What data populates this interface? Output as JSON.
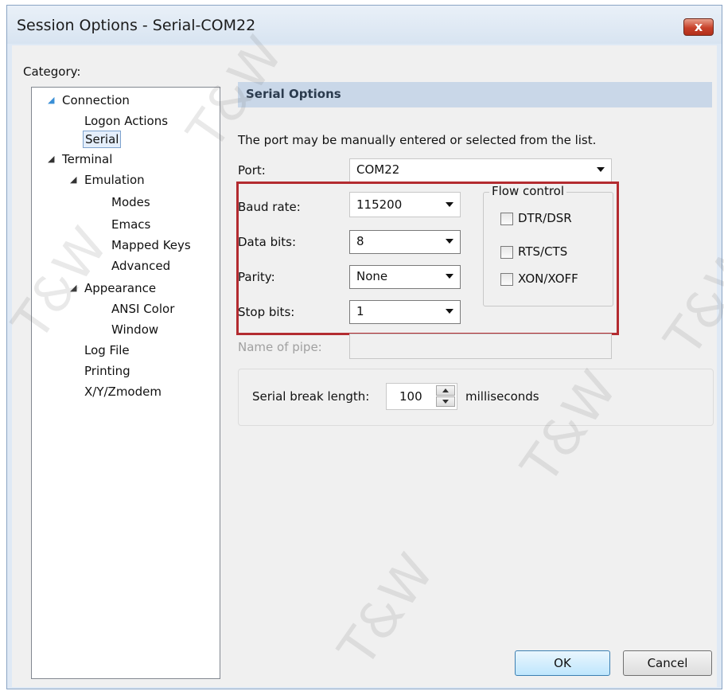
{
  "window": {
    "title": "Session Options - Serial-COM22",
    "close_symbol": "x"
  },
  "category_label": "Category:",
  "tree": {
    "connection": "Connection",
    "logon_actions": "Logon Actions",
    "serial": "Serial",
    "terminal": "Terminal",
    "emulation": "Emulation",
    "modes": "Modes",
    "emacs": "Emacs",
    "mapped_keys": "Mapped Keys",
    "advanced": "Advanced",
    "appearance": "Appearance",
    "ansi_color": "ANSI Color",
    "window": "Window",
    "log_file": "Log File",
    "printing": "Printing",
    "xyz_modem": "X/Y/Zmodem",
    "expand_symbol": "◢"
  },
  "serial_options": {
    "header": "Serial Options",
    "description": "The port may be manually entered or selected from the list.",
    "port_label": "Port:",
    "port_value": "COM22",
    "baud_label": "Baud rate:",
    "baud_value": "115200",
    "data_bits_label": "Data bits:",
    "data_bits_value": "8",
    "parity_label": "Parity:",
    "parity_value": "None",
    "stop_bits_label": "Stop bits:",
    "stop_bits_value": "1",
    "pipe_label": "Name of pipe:",
    "pipe_value": ""
  },
  "flow_control": {
    "title": "Flow control",
    "dtr_dsr": "DTR/DSR",
    "rts_cts": "RTS/CTS",
    "xon_xoff": "XON/XOFF",
    "dtr_dsr_checked": false,
    "rts_cts_checked": false,
    "xon_xoff_checked": false
  },
  "serial_break": {
    "label": "Serial break length:",
    "value": "100",
    "unit": "milliseconds"
  },
  "buttons": {
    "ok": "OK",
    "cancel": "Cancel"
  },
  "watermark": "T&W",
  "colors": {
    "highlight_border": "#b32b30",
    "header_bg": "#c9d7e8",
    "close_button": "#c7412a"
  }
}
